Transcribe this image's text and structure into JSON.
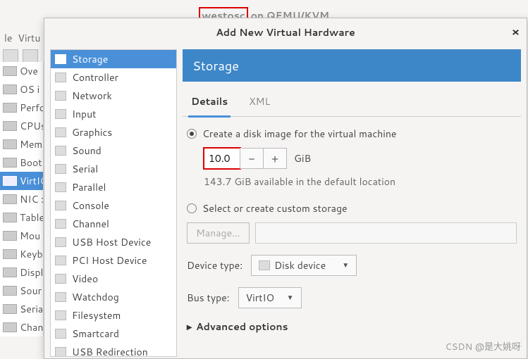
{
  "background": {
    "title_prefix": "westosc",
    "title_suffix": " on QEMU/KVM",
    "menus": [
      "le",
      "Virtu"
    ],
    "left_items": [
      "Ove",
      "OS i",
      "Perfo",
      "CPUs",
      "Mem",
      "Boot",
      "VirtIO",
      "NIC :",
      "Table",
      "Mou",
      "Keyb",
      "Displ",
      "Sour",
      "Seria",
      "Chan"
    ],
    "left_selected_index": 6
  },
  "dialog": {
    "title": "Add New Virtual Hardware",
    "close": "×",
    "categories": [
      "Storage",
      "Controller",
      "Network",
      "Input",
      "Graphics",
      "Sound",
      "Serial",
      "Parallel",
      "Console",
      "Channel",
      "USB Host Device",
      "PCI Host Device",
      "Video",
      "Watchdog",
      "Filesystem",
      "Smartcard",
      "USB Redirection"
    ],
    "selected_category": 0,
    "header": "Storage",
    "tabs": {
      "details": "Details",
      "xml": "XML",
      "active": 0
    },
    "form": {
      "create_label": "Create a disk image for the virtual machine",
      "size_value": "10.0",
      "minus": "−",
      "plus": "+",
      "unit": "GiB",
      "available": "143.7 GiB available in the default location",
      "custom_label": "Select or create custom storage",
      "manage": "Manage...",
      "device_type_label": "Device type:",
      "device_type_value": "Disk device",
      "bus_type_label": "Bus type:",
      "bus_type_value": "VirtIO",
      "advanced": "Advanced options"
    }
  },
  "watermark": "CSDN @是大姚呀"
}
